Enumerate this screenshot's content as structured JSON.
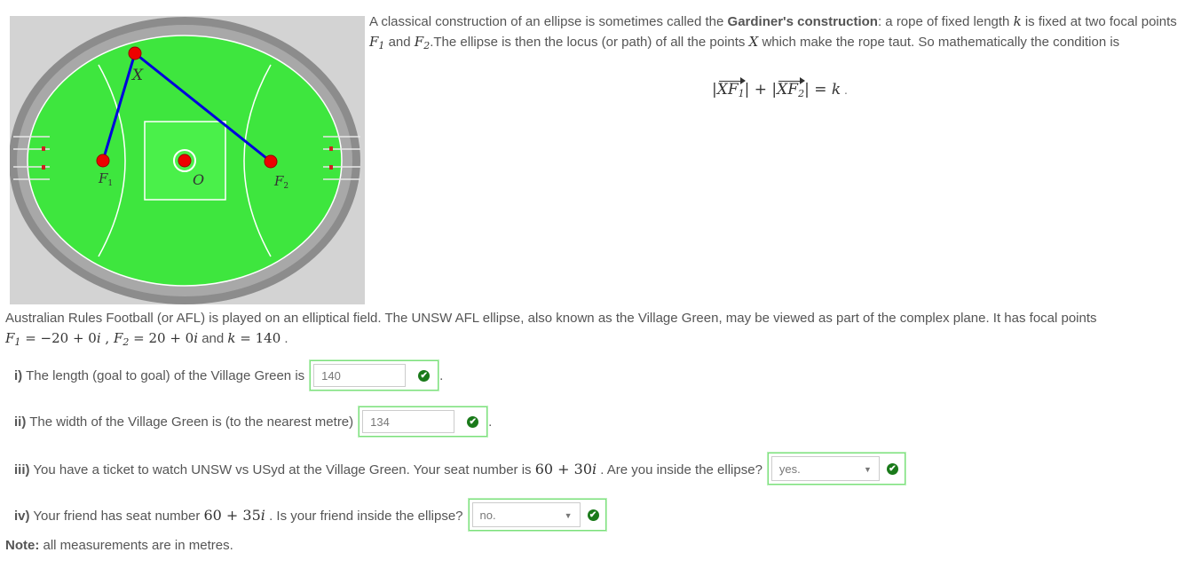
{
  "figure": {
    "labels": {
      "x": "X",
      "f1": "F",
      "f1_sub": "1",
      "f2": "F",
      "f2_sub": "2",
      "o": "O"
    },
    "colors": {
      "field": "#3ee63e",
      "rim": "#8c8c8c",
      "rope": "#0000dd",
      "point": "#ee0000",
      "background": "#d3d3d3"
    }
  },
  "intro": {
    "t1": "A classical construction of an ellipse is sometimes called the ",
    "bold": "Gardiner's construction",
    "t2": ": a rope of fixed length ",
    "k": "k",
    "t3": " is fixed at two focal points ",
    "f": "F",
    "s1": "1",
    "t4": " and ",
    "s2": "2",
    "t5": ".The ellipse is then the locus (or path) of all the points ",
    "x": "X",
    "t6": " which make the rope taut. So mathematically the condition is"
  },
  "formula": {
    "bar1": "|",
    "xf": "XF",
    "s1": "1",
    "s2": "2",
    "bar_plus": "| + |",
    "bar_eq": "| = ",
    "k": "k",
    "end": " ."
  },
  "desc": {
    "t1": "Australian Rules Football (or AFL) is played on an elliptical field. The UNSW AFL ellipse, also known as the Village Green, may be viewed as part of the complex plane. It has focal points ",
    "f": "F",
    "s1": "1",
    "v1": " = −20 + 0",
    "i": "i",
    "c": " , ",
    "s2": "2",
    "v2": " = 20 + 0",
    "and": "  and ",
    "k": "k",
    "kv": " = 140",
    "end": " ."
  },
  "q1": {
    "num": "i)",
    "text": " The length (goal to goal) of the Village Green is",
    "value": "140"
  },
  "q2": {
    "num": "ii)",
    "text": " The width of the Village Green is (to the nearest metre)",
    "value": "134"
  },
  "q3": {
    "num": "iii)",
    "text": " You have a ticket to watch UNSW vs USyd at the Village Green. Your seat number is ",
    "seat": "60 + 30",
    "i": "i",
    "text2": " . Are you inside the ellipse?",
    "value": "yes."
  },
  "q4": {
    "num": "iv)",
    "text": " Your friend has seat number ",
    "seat": "60 + 35",
    "i": "i",
    "text2": " . Is your friend inside the ellipse?",
    "value": "no."
  },
  "check_glyph": "✔",
  "dot": ".",
  "arrow": "▼",
  "note": {
    "bold": "Note:",
    "text": " all measurements are in metres."
  }
}
